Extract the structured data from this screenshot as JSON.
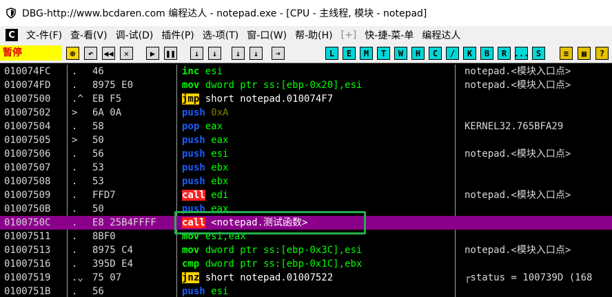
{
  "window": {
    "title": "DBG-http://www.bcdaren.com 编程达人 - notepad.exe - [CPU -  主线程, 模块 - notepad]"
  },
  "menu": {
    "logo": "C",
    "items": [
      {
        "label": "文-件(F)"
      },
      {
        "label": "查-看(V)"
      },
      {
        "label": "调-试(D)"
      },
      {
        "label": "插件(P)"
      },
      {
        "label": "选-项(T)"
      },
      {
        "label": "窗-口(W)"
      },
      {
        "label": "帮-助(H)"
      },
      {
        "label": "[+]"
      },
      {
        "label": "快-捷-菜-单"
      },
      {
        "label": "编程达人"
      }
    ]
  },
  "toolbar": {
    "status": "暂停",
    "buttons_a": [
      "⊕",
      "↶",
      "◀◀",
      "✕",
      "▶",
      "❚❚",
      "↓",
      "↓",
      "↓",
      "↓",
      "➔"
    ],
    "buttons_b": [
      "L",
      "E",
      "M",
      "T",
      "W",
      "H",
      "C",
      "/",
      "K",
      "B",
      "R",
      "...",
      "S"
    ],
    "buttons_c": [
      "≡",
      "▦",
      "?"
    ]
  },
  "disasm": {
    "rows": [
      {
        "addr": "010074FC",
        "arrow": ".",
        "hex": "46",
        "mn": "inc",
        "mt": "green",
        "ops": "esi",
        "ot": "green",
        "cmt": "notepad.<模块入口点>"
      },
      {
        "addr": "010074FD",
        "arrow": ".",
        "hex": "8975 E0",
        "mn": "mov",
        "mt": "green",
        "ops": "dword ptr ss:[ebp-0x20],esi",
        "ot": "green",
        "cmt": "notepad.<模块入口点>"
      },
      {
        "addr": "01007500",
        "arrow": ".^",
        "hex": "EB F5",
        "mn": "jmp",
        "mt": "jmp",
        "ops": "short notepad.010074F7",
        "ot": "white",
        "cmt": ""
      },
      {
        "addr": "01007502",
        "arrow": ">",
        "hex": "6A 0A",
        "mn": "push",
        "mt": "blue",
        "ops": "0xA",
        "ot": "dim",
        "cmt": ""
      },
      {
        "addr": "01007504",
        "arrow": ".",
        "hex": "58",
        "mn": "pop",
        "mt": "blue",
        "ops": "eax",
        "ot": "green",
        "cmt": "KERNEL32.765BFA29"
      },
      {
        "addr": "01007505",
        "arrow": ">",
        "hex": "50",
        "mn": "push",
        "mt": "blue",
        "ops": "eax",
        "ot": "green",
        "cmt": ""
      },
      {
        "addr": "01007506",
        "arrow": ".",
        "hex": "56",
        "mn": "push",
        "mt": "blue",
        "ops": "esi",
        "ot": "green",
        "cmt": "notepad.<模块入口点>"
      },
      {
        "addr": "01007507",
        "arrow": ".",
        "hex": "53",
        "mn": "push",
        "mt": "blue",
        "ops": "ebx",
        "ot": "green",
        "cmt": ""
      },
      {
        "addr": "01007508",
        "arrow": ".",
        "hex": "53",
        "mn": "push",
        "mt": "blue",
        "ops": "ebx",
        "ot": "green",
        "cmt": ""
      },
      {
        "addr": "01007509",
        "arrow": ".",
        "hex": "FFD7",
        "mn": "call",
        "mt": "call",
        "ops": "edi",
        "ot": "green",
        "cmt": "notepad.<模块入口点>"
      },
      {
        "addr": "0100750B",
        "arrow": ".",
        "hex": "50",
        "mn": "push",
        "mt": "blue",
        "ops": "eax",
        "ot": "green",
        "cmt": ""
      },
      {
        "addr": "0100750C",
        "arrow": ".",
        "hex": "E8 25B4FFFF",
        "mn": "call",
        "mt": "call",
        "ops": "<notepad.测试函数>",
        "ot": "white",
        "cmt": "",
        "selected": true
      },
      {
        "addr": "01007511",
        "arrow": ".",
        "hex": "8BF0",
        "mn": "mov",
        "mt": "green",
        "ops": "esi,eax",
        "ot": "green",
        "cmt": ""
      },
      {
        "addr": "01007513",
        "arrow": ".",
        "hex": "8975 C4",
        "mn": "mov",
        "mt": "green",
        "ops": "dword ptr ss:[ebp-0x3C],esi",
        "ot": "green",
        "cmt": "notepad.<模块入口点>"
      },
      {
        "addr": "01007516",
        "arrow": ".",
        "hex": "395D E4",
        "mn": "cmp",
        "mt": "green",
        "ops": "dword ptr ss:[ebp-0x1C],ebx",
        "ot": "green",
        "cmt": ""
      },
      {
        "addr": "01007519",
        "arrow": ".⌄",
        "hex": "75 07",
        "mn": "jnz",
        "mt": "jmp",
        "ops": "short notepad.01007522",
        "ot": "white",
        "cmt": "┌status = 100739D (168"
      },
      {
        "addr": "0100751B",
        "arrow": ".",
        "hex": "56",
        "mn": "push",
        "mt": "blue",
        "ops": "esi",
        "ot": "green",
        "cmt": ""
      }
    ]
  },
  "colors": {
    "selected_row": "#8b008b",
    "highlight_box": "#24b04a",
    "status_bg": "#ffff00",
    "status_fg": "#e00000"
  }
}
